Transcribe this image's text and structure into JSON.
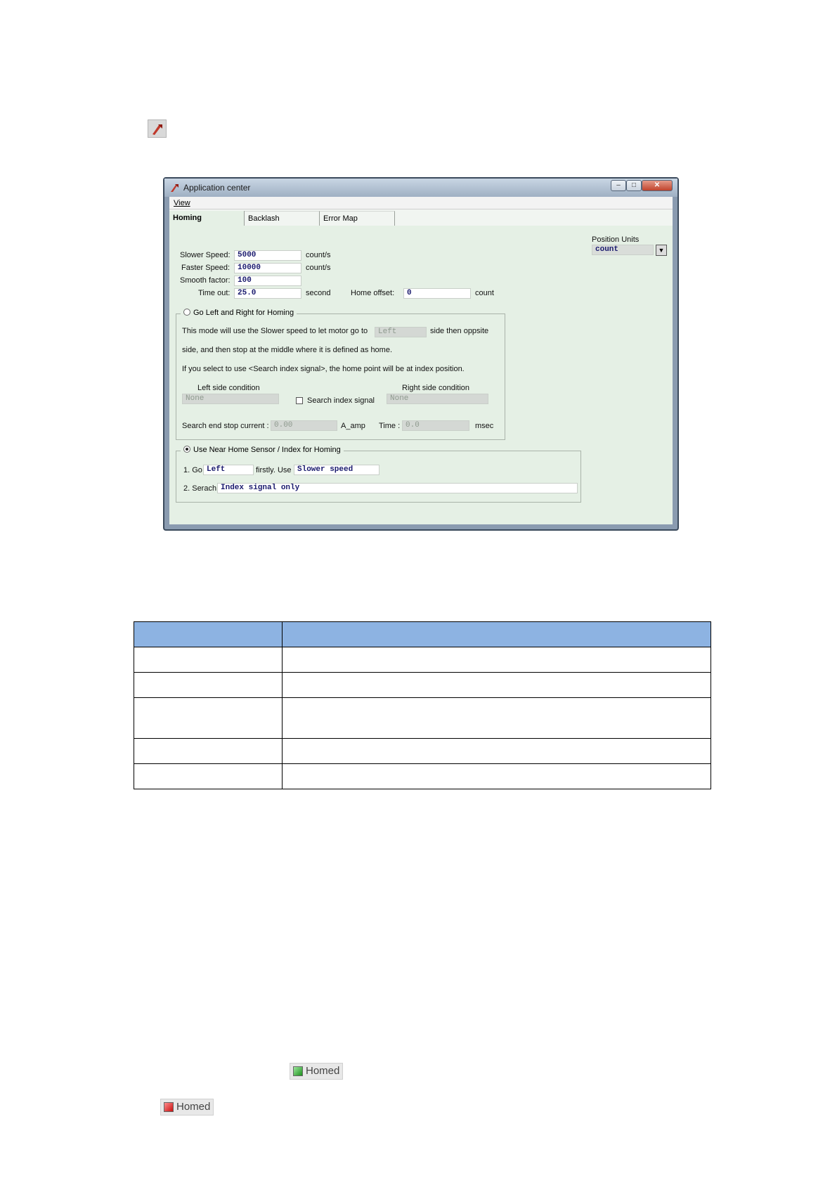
{
  "window": {
    "title": "Application center",
    "menu_view": "View",
    "buttons": {
      "minimize": "–",
      "maximize": "□",
      "close": "✕"
    },
    "icon": "application-center-icon"
  },
  "tabs": [
    "Homing",
    "Backlash",
    "Error Map"
  ],
  "position_units": {
    "label": "Position Units",
    "value": "count",
    "arrow": "▼"
  },
  "params": {
    "slower_speed": {
      "label": "Slower Speed:",
      "value": "5000",
      "unit": "count/s"
    },
    "faster_speed": {
      "label": "Faster Speed:",
      "value": "10000",
      "unit": "count/s"
    },
    "smooth_factor": {
      "label": "Smooth factor:",
      "value": "100"
    },
    "time_out": {
      "label": "Time out:",
      "value": "25.0",
      "unit": "second"
    },
    "home_offset": {
      "label": "Home offset:",
      "value": "0",
      "unit": "count"
    }
  },
  "mode1": {
    "title": "Go Left and Right for Homing",
    "desc_a": "This mode will use the Slower speed to let motor go to",
    "side_value": "Left",
    "desc_b": "side then oppsite",
    "desc_c": "side, and then stop at the middle where it is defined as home.",
    "desc_d": "If you select to use <Search index signal>, the home point will be at index position.",
    "left_label": "Left side condition",
    "left_value": "None",
    "search_index_label": "Search index signal",
    "right_label": "Right side condition",
    "right_value": "None",
    "current_label": "Search end stop current :",
    "current_value": "0.00",
    "current_unit": "A_amp",
    "time_label": "Time :",
    "time_value": "0.0",
    "time_unit": "msec"
  },
  "mode2": {
    "title": "Use Near Home Sensor / Index for Homing",
    "step1_go": "1. Go",
    "direction_value": "Left",
    "step1_use": "firstly. Use",
    "speed_value": "Slower speed",
    "step2_label": "2. Serach",
    "search_value": "Index signal only"
  },
  "table": {
    "header": [
      "",
      ""
    ],
    "rows": [
      [
        "",
        ""
      ],
      [
        "",
        ""
      ],
      [
        "",
        ""
      ],
      [
        "",
        ""
      ],
      [
        "",
        ""
      ]
    ]
  },
  "status": {
    "homed_green": "Homed",
    "homed_red": "Homed",
    "colors": {
      "green": "#1c8f1c",
      "red": "#c81010"
    }
  }
}
